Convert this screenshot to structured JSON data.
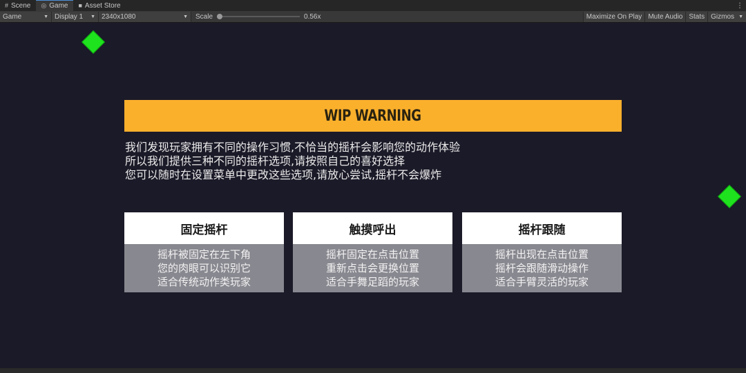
{
  "tabs": [
    {
      "icon": "scene-icon",
      "glyph": "#",
      "label": "Scene"
    },
    {
      "icon": "gamepad-icon",
      "glyph": "◎",
      "label": "Game"
    },
    {
      "icon": "store-icon",
      "glyph": "■",
      "label": "Asset Store"
    }
  ],
  "toolbar": {
    "view_mode": "Game",
    "display": "Display 1",
    "resolution": "2340x1080",
    "scale_label": "Scale",
    "scale_value": "0.56x",
    "maximize": "Maximize On Play",
    "mute": "Mute Audio",
    "stats": "Stats",
    "gizmos": "Gizmos"
  },
  "warning": {
    "title": "WIP WARNING",
    "lines": [
      "我们发现玩家拥有不同的操作习惯,不恰当的摇杆会影响您的动作体验",
      "所以我们提供三种不同的摇杆选项,请按照自己的喜好选择",
      "您可以随时在设置菜单中更改这些选项,请放心尝试,摇杆不会爆炸"
    ]
  },
  "options": [
    {
      "title": "固定摇杆",
      "lines": [
        "摇杆被固定在左下角",
        "您的肉眼可以识别它",
        "适合传统动作类玩家"
      ]
    },
    {
      "title": "触摸呼出",
      "lines": [
        "摇杆固定在点击位置",
        "重新点击会更换位置",
        "适合手舞足蹈的玩家"
      ]
    },
    {
      "title": "摇杆跟随",
      "lines": [
        "摇杆出现在点击位置",
        "摇杆会跟随滑动操作",
        "适合手臂灵活的玩家"
      ]
    }
  ],
  "colors": {
    "banner": "#fbb02c",
    "background": "#1b1a28",
    "marker": "#1ee21e",
    "card_body": "#888890"
  }
}
